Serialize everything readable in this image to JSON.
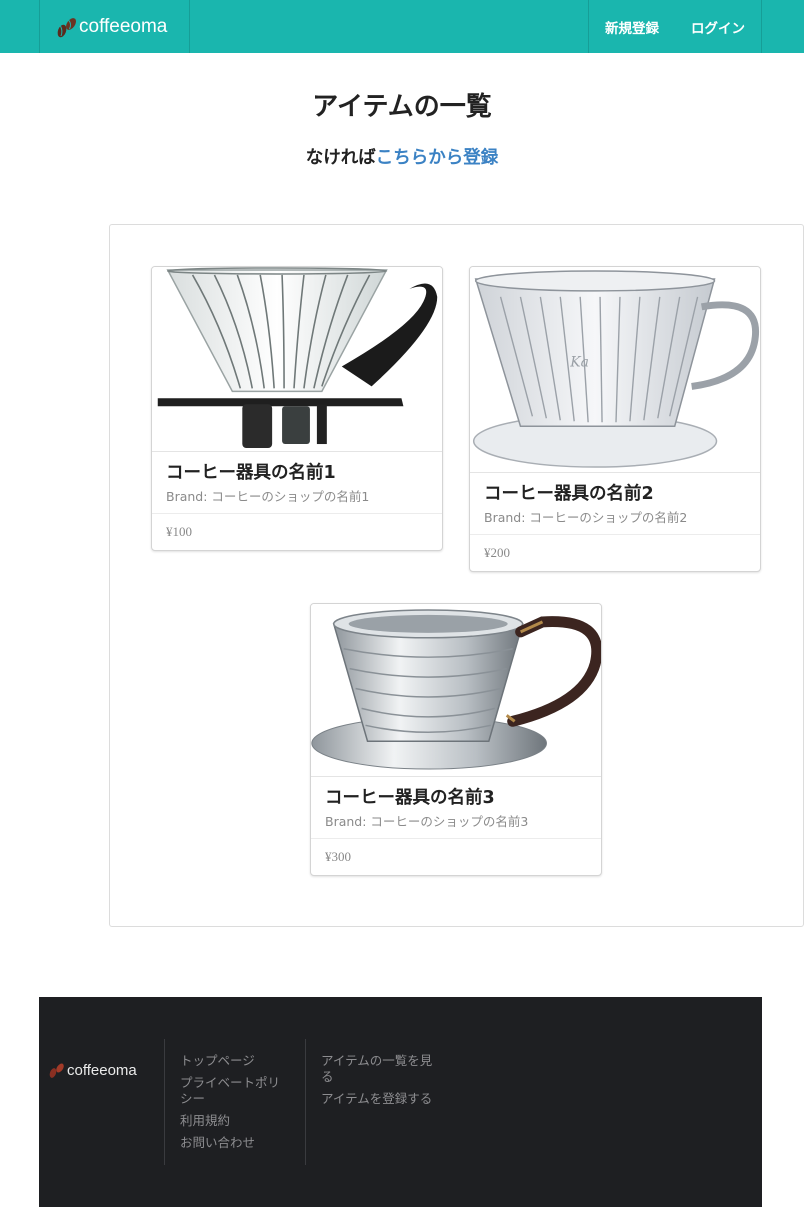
{
  "navbar": {
    "brand": "coffeeoma",
    "links": [
      {
        "label": "新規登録"
      },
      {
        "label": "ログイン"
      }
    ]
  },
  "header": {
    "title": "アイテムの一覧",
    "subtitle_prefix": "なければ",
    "subtitle_link": "こちらから登録"
  },
  "items": [
    {
      "name": "コーヒー器具の名前1",
      "brand": "Brand: コーヒーのショップの名前1",
      "price": "¥100",
      "image": "glass-v60-dripper"
    },
    {
      "name": "コーヒー器具の名前2",
      "brand": "Brand: コーヒーのショップの名前2",
      "price": "¥200",
      "image": "kalita-plastic-dripper"
    },
    {
      "name": "コーヒー器具の名前3",
      "brand": "Brand: コーヒーのショップの名前3",
      "price": "¥300",
      "image": "kalita-wave-stainless-dripper"
    }
  ],
  "footer": {
    "brand": "coffeeoma",
    "col1": [
      "トップページ",
      "プライベートポリシー",
      "利用規約",
      "お問い合わせ"
    ],
    "col2": [
      "アイテムの一覧を見る",
      "アイテムを登録する"
    ]
  },
  "colors": {
    "navbar": "#1ab6ae",
    "link": "#3b82c4",
    "footer": "#1e1f22"
  }
}
